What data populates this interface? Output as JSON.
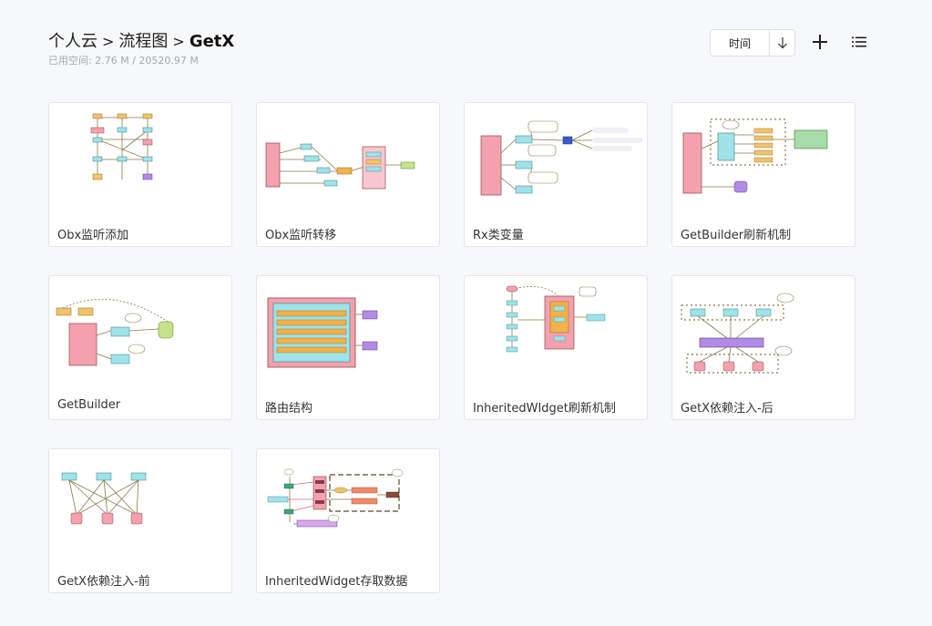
{
  "breadcrumb": {
    "items": [
      "个人云",
      "流程图"
    ],
    "separator": ">",
    "current": "GetX"
  },
  "storage": {
    "label": "已用空间:",
    "used": "2.76 M",
    "divider": "/",
    "total": "20520.97 M"
  },
  "toolbar": {
    "sort_label": "时间",
    "sort_direction_icon": "arrow-down-icon",
    "add_icon": "plus-icon",
    "view_icon": "list-view-icon"
  },
  "files": [
    {
      "title": "Obx监听添加"
    },
    {
      "title": "Obx监听转移"
    },
    {
      "title": "Rx类变量"
    },
    {
      "title": "GetBuilder刷新机制"
    },
    {
      "title": "GetBuilder"
    },
    {
      "title": "路由结构"
    },
    {
      "title": "InheritedWIdget刷新机制"
    },
    {
      "title": "GetX依赖注入-后"
    },
    {
      "title": "GetX依赖注入-前"
    },
    {
      "title": "InheritedWidget存取数据"
    }
  ]
}
